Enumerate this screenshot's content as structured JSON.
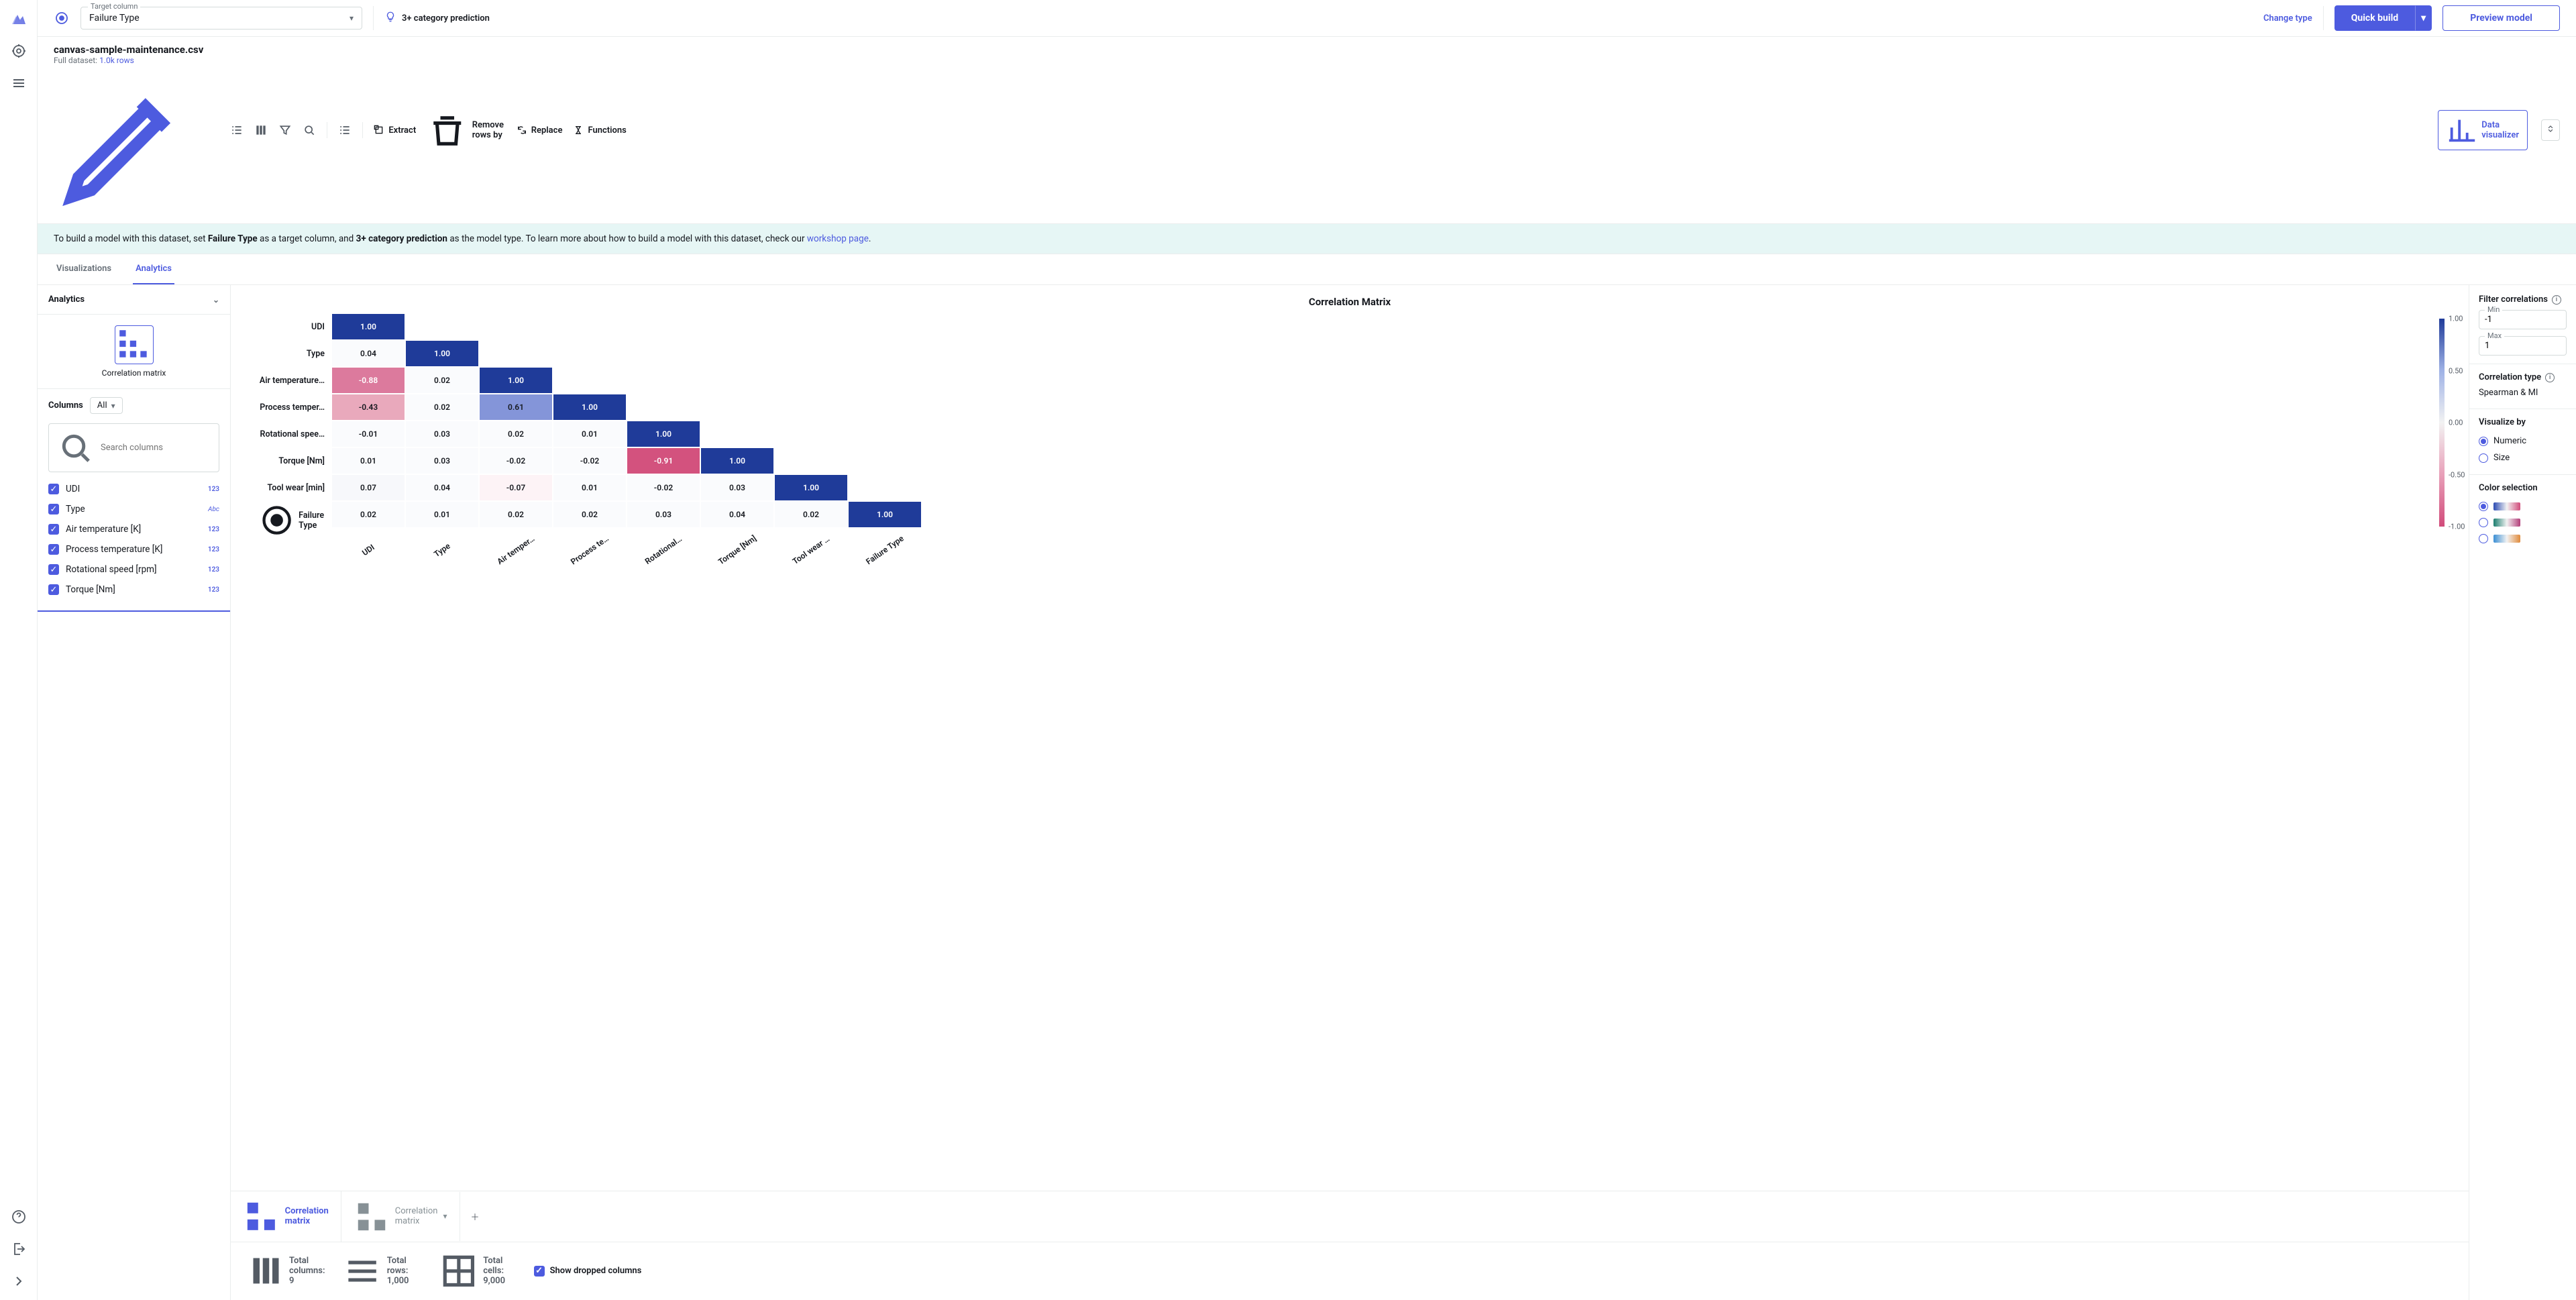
{
  "topbar": {
    "target_label": "Target column",
    "target_value": "Failure Type",
    "prediction_type": "3+ category prediction",
    "change_type": "Change type",
    "quick_build": "Quick build",
    "preview_model": "Preview model"
  },
  "file": {
    "name": "canvas-sample-maintenance.csv",
    "full_dataset": "Full dataset:",
    "rows": "1.0k rows"
  },
  "toolbar": {
    "extract": "Extract",
    "remove_rows": "Remove rows by",
    "replace": "Replace",
    "functions": "Functions",
    "data_visualizer": "Data visualizer"
  },
  "banner": {
    "pre": "To build a model with this dataset, set ",
    "b1": "Failure Type",
    "mid1": " as a target column, and ",
    "b2": "3+ category prediction",
    "mid2": " as the model type. To learn more about how to build a model with this dataset, check our ",
    "link": "workshop page",
    "post": "."
  },
  "tabs": {
    "viz": "Visualizations",
    "analytics": "Analytics"
  },
  "side": {
    "analytics": "Analytics",
    "corr_thumb": "Correlation matrix",
    "columns": "Columns",
    "all": "All",
    "search_ph": "Search columns",
    "cols": [
      {
        "name": "UDI",
        "type": "123"
      },
      {
        "name": "Type",
        "type": "Abc"
      },
      {
        "name": "Air temperature [K]",
        "type": "123"
      },
      {
        "name": "Process temperature [K]",
        "type": "123"
      },
      {
        "name": "Rotational speed [rpm]",
        "type": "123"
      },
      {
        "name": "Torque [Nm]",
        "type": "123"
      }
    ]
  },
  "chart_data": {
    "type": "heatmap",
    "title": "Correlation Matrix",
    "row_labels": [
      "UDI",
      "Type",
      "Air temperature…",
      "Process temper…",
      "Rotational spee…",
      "Torque [Nm]",
      "Tool wear [min]",
      "Failure Type"
    ],
    "col_labels": [
      "UDI",
      "Type",
      "Air temper…",
      "Process te…",
      "Rotational…",
      "Torque [Nm]",
      "Tool wear …",
      "Failure Type"
    ],
    "values": [
      [
        1.0,
        null,
        null,
        null,
        null,
        null,
        null,
        null
      ],
      [
        0.04,
        1.0,
        null,
        null,
        null,
        null,
        null,
        null
      ],
      [
        -0.88,
        0.02,
        1.0,
        null,
        null,
        null,
        null,
        null
      ],
      [
        -0.43,
        0.02,
        0.61,
        1.0,
        null,
        null,
        null,
        null
      ],
      [
        -0.01,
        0.03,
        0.02,
        0.01,
        1.0,
        null,
        null,
        null
      ],
      [
        0.01,
        0.03,
        -0.02,
        -0.02,
        -0.91,
        1.0,
        null,
        null
      ],
      [
        0.07,
        0.04,
        -0.07,
        0.01,
        -0.02,
        0.03,
        1.0,
        null
      ],
      [
        0.02,
        0.01,
        0.02,
        0.02,
        0.03,
        0.04,
        0.02,
        1.0
      ]
    ],
    "scale_ticks": [
      "1.00",
      "0.50",
      "0.00",
      "-0.50",
      "-1.00"
    ],
    "target_row_index": 7
  },
  "right": {
    "filter": "Filter correlations",
    "min_label": "Min",
    "min": "-1",
    "max_label": "Max",
    "max": "1",
    "corr_type_label": "Correlation type",
    "corr_type": "Spearman & MI",
    "viz_by": "Visualize by",
    "numeric": "Numeric",
    "size": "Size",
    "color_sel": "Color selection"
  },
  "bottom_tabs": {
    "active": "Correlation matrix",
    "muted": "Correlation matrix"
  },
  "status": {
    "cols": "Total columns: 9",
    "rows": "Total rows: 1,000",
    "cells": "Total cells: 9,000",
    "dropped": "Show dropped columns"
  }
}
